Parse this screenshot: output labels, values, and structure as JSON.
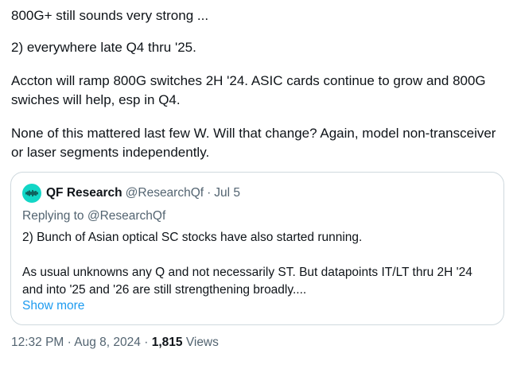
{
  "tweet": {
    "paragraphs": [
      "800G+ still sounds very strong ...",
      "2) everywhere late Q4 thru '25.",
      "Accton will ramp 800G switches 2H '24. ASIC cards continue to grow and 800G swiches will help, esp in Q4.",
      "None of this mattered last few W. Will that change? Again, model non-transceiver or laser segments independently."
    ],
    "time": "12:32 PM",
    "separator": "·",
    "date": "Aug 8, 2024",
    "views_count": "1,815",
    "views_label": "Views"
  },
  "quote": {
    "avatar_icon": "waveform-icon",
    "avatar_color": "#12d6c6",
    "author_name": "QF Research",
    "author_handle": "@ResearchQf",
    "separator": "·",
    "date": "Jul 5",
    "replying_to": "Replying to @ResearchQf",
    "body": [
      "2) Bunch of Asian optical SC  stocks have also started running.",
      "As usual unknowns any Q and not necessarily ST. But datapoints IT/LT thru 2H '24 and into '25 and '26 are still strengthening broadly...."
    ],
    "show_more": "Show more"
  },
  "colors": {
    "text": "#0f1419",
    "secondary": "#536471",
    "link": "#1d9bf0",
    "border": "#cfd9de"
  }
}
